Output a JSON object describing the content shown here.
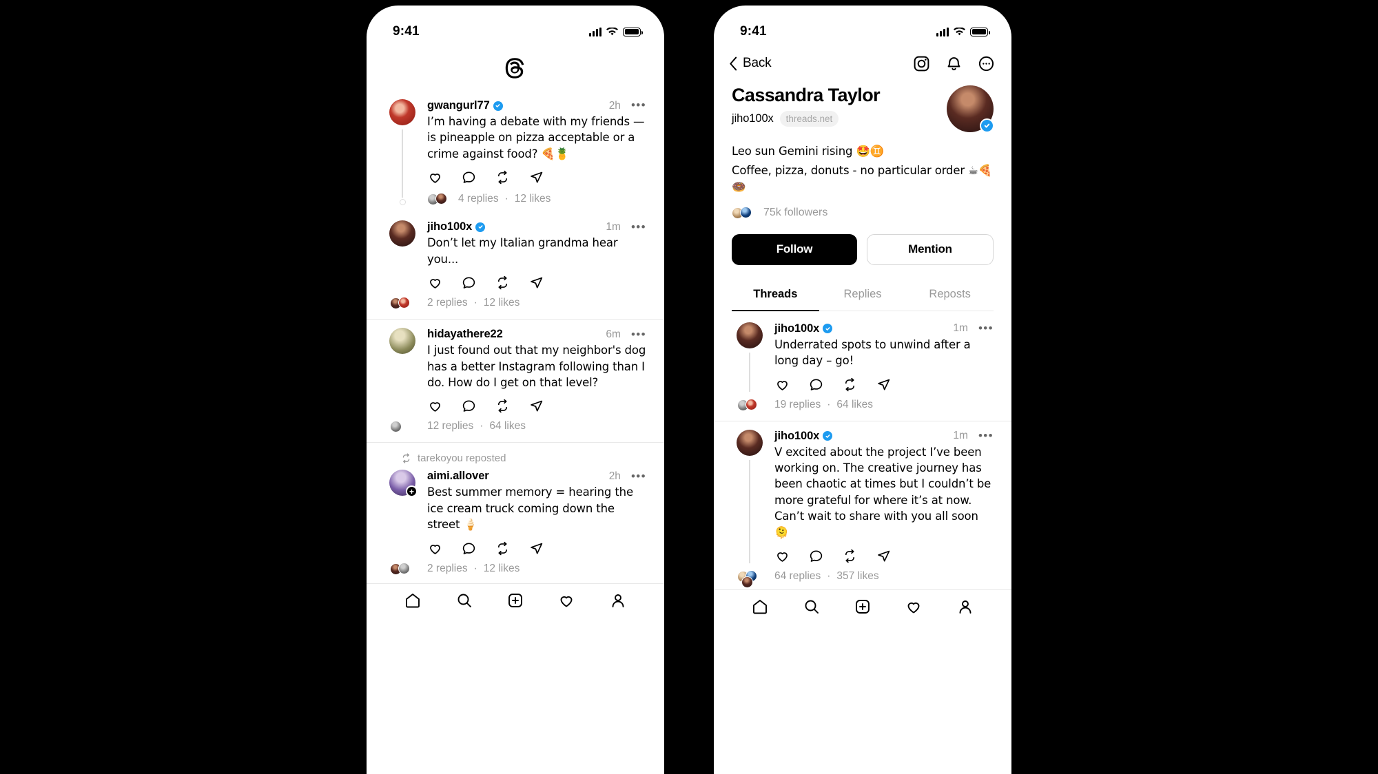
{
  "status_bar": {
    "time": "9:41"
  },
  "phone1": {
    "app_logo": "threads-logo",
    "posts": [
      {
        "username": "gwangurl77",
        "verified": true,
        "time": "2h",
        "text": "I’m having a debate with my friends — is pineapple on pizza acceptable or a crime against food? 🍕🍍",
        "replies": "4 replies",
        "likes": "12 likes",
        "separator": "·"
      },
      {
        "username": "jiho100x",
        "verified": true,
        "time": "1m",
        "text": "Don’t let my Italian grandma hear you...",
        "replies": "2 replies",
        "likes": "12 likes",
        "separator": "·"
      },
      {
        "username": "hidayathere22",
        "verified": false,
        "time": "6m",
        "text": "I just found out that my neighbor's dog has a better Instagram following than I do. How do I get on that level?",
        "replies": "12 replies",
        "likes": "64 likes",
        "separator": "·"
      },
      {
        "repost_label": "tarekoyou reposted",
        "username": "aimi.allover",
        "verified": false,
        "time": "2h",
        "text": "Best summer memory = hearing the ice cream truck coming down the street 🍦",
        "replies": "2 replies",
        "likes": "12 likes",
        "separator": "·"
      }
    ],
    "action_icons": [
      "like-icon",
      "reply-icon",
      "repost-icon",
      "share-icon"
    ],
    "more_label": "•••"
  },
  "phone2": {
    "nav": {
      "back_label": "Back",
      "icons": [
        "instagram-icon",
        "bell-icon",
        "more-icon"
      ]
    },
    "profile": {
      "display_name": "Cassandra Taylor",
      "handle": "jiho100x",
      "domain_chip": "threads.net",
      "verified": true,
      "bio_line1": "Leo sun Gemini rising 🤩♊️",
      "bio_line2": "Coffee, pizza, donuts - no particular order ☕🍕🍩",
      "followers": "75k followers",
      "follow_button": "Follow",
      "mention_button": "Mention"
    },
    "tabs": [
      {
        "label": "Threads",
        "active": true
      },
      {
        "label": "Replies",
        "active": false
      },
      {
        "label": "Reposts",
        "active": false
      }
    ],
    "posts": [
      {
        "username": "jiho100x",
        "verified": true,
        "time": "1m",
        "text": "Underrated spots to unwind after a long day – go!",
        "replies": "19 replies",
        "likes": "64 likes",
        "separator": "·"
      },
      {
        "username": "jiho100x",
        "verified": true,
        "time": "1m",
        "text": "V excited about the project I’ve been working on. The creative journey has been chaotic at times but I couldn’t be more grateful for where it’s at now. Can’t wait to share with you all soon 🫠",
        "replies": "64 replies",
        "likes": "357 likes",
        "separator": "·"
      }
    ]
  },
  "colors": {
    "verified_blue": "#1d9bf0",
    "muted": "#999999",
    "accent_black": "#000000",
    "divider": "#e8e8e8"
  }
}
